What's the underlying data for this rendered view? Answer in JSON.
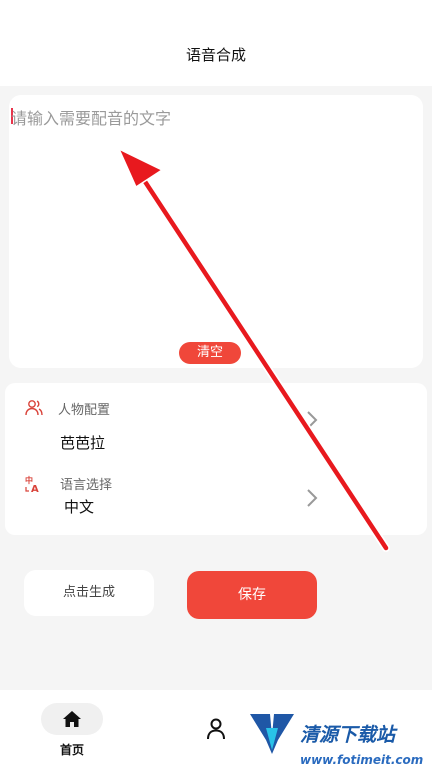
{
  "header": {
    "title": "语音合成"
  },
  "input": {
    "placeholder": "请输入需要配音的文字",
    "value": "",
    "clear_label": "清空"
  },
  "config": {
    "character": {
      "label": "人物配置",
      "value": "芭芭拉",
      "icon": "people-icon"
    },
    "language": {
      "label": "语言选择",
      "value": "中文",
      "icon": "translate-icon"
    }
  },
  "actions": {
    "generate_label": "点击生成",
    "save_label": "保存"
  },
  "nav": {
    "home_label": "首页"
  },
  "watermark": {
    "title": "清源下载站",
    "url": "www.fotimeit.com"
  },
  "colors": {
    "accent": "#f0473a",
    "background": "#f5f5f5",
    "arrow": "#e8191e"
  }
}
